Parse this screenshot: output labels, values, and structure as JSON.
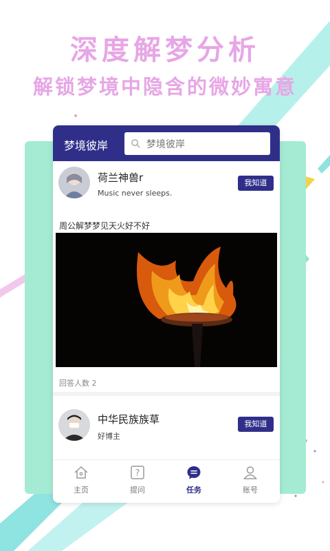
{
  "promo": {
    "title": "深度解梦分析",
    "subtitle": "解锁梦境中隐含的微妙寓意"
  },
  "app": {
    "title": "梦境彼岸",
    "search_placeholder": "梦境彼岸"
  },
  "posts": [
    {
      "user_name": "荷兰神兽r",
      "user_sub": "Music never sleeps.",
      "button_label": "我知道",
      "question": "周公解梦梦见天火好不好",
      "answer_count": "回答人数 2"
    },
    {
      "user_name": "中华民族族草",
      "user_sub": "好博主",
      "button_label": "我知道"
    }
  ],
  "tabs": [
    {
      "label": "主页",
      "icon": "home-icon"
    },
    {
      "label": "提问",
      "icon": "question-icon"
    },
    {
      "label": "任务",
      "icon": "chat-icon",
      "active": true
    },
    {
      "label": "账号",
      "icon": "user-icon"
    }
  ],
  "colors": {
    "brand": "#2f2f8a",
    "promo_text": "#e7a6e6",
    "mint": "#a5ebd3"
  }
}
